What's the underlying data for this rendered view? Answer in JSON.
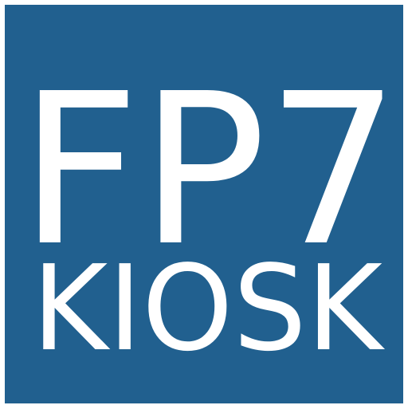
{
  "icon": {
    "title": "FP7",
    "subtitle": "KIOSK",
    "background_color": "#21608f",
    "text_color": "#ffffff",
    "border_color": "#ffffff"
  }
}
